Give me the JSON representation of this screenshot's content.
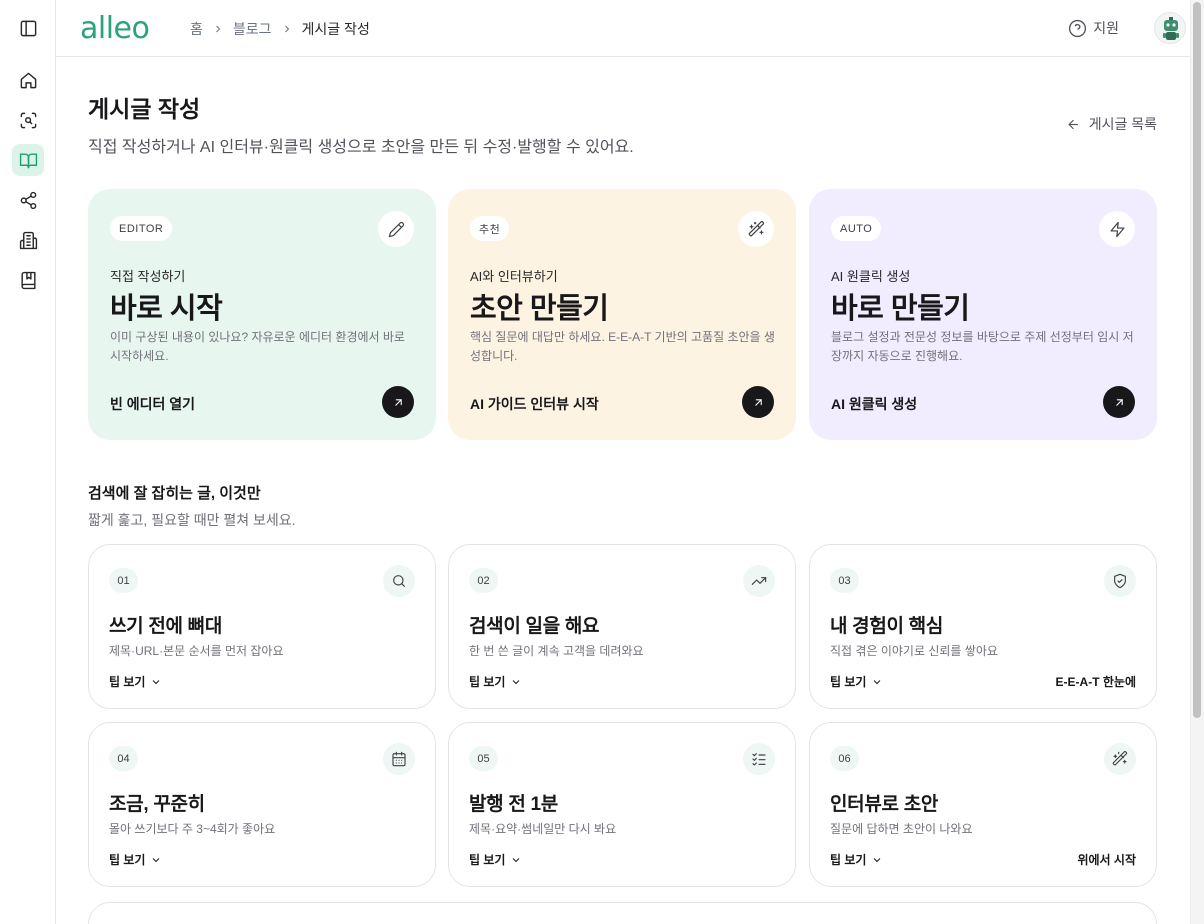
{
  "app": {
    "logo": "alleo",
    "support_label": "지원"
  },
  "breadcrumb": [
    "홈",
    "블로그",
    "게시글 작성"
  ],
  "sidebar": {
    "items": [
      {
        "name": "sidebar-toggle",
        "icon": "sidebar-panel-icon"
      },
      {
        "name": "home",
        "icon": "home-icon"
      },
      {
        "name": "scan",
        "icon": "scan-search-icon"
      },
      {
        "name": "blog",
        "icon": "book-open-icon",
        "active": true
      },
      {
        "name": "share",
        "icon": "share-icon"
      },
      {
        "name": "building",
        "icon": "building-icon"
      },
      {
        "name": "bookmark-book",
        "icon": "book-bookmark-icon"
      }
    ]
  },
  "page": {
    "title": "게시글 작성",
    "subtitle": "직접 작성하거나 AI 인터뷰·원클릭 생성으로 초안을 만든 뒤 수정·발행할 수 있어요.",
    "back_label": "게시글 목록"
  },
  "cards": [
    {
      "badge": "EDITOR",
      "icon": "pencil-icon",
      "kicker": "직접 작성하기",
      "headline": "바로 시작",
      "desc": "이미 구상된 내용이 있나요? 자유로운 에디터 환경에서 바로 시작하세요.",
      "action": "빈 에디터 열기",
      "bg": "#e8f6f0"
    },
    {
      "badge": "추천",
      "icon": "magic-wand-icon",
      "kicker": "AI와 인터뷰하기",
      "headline": "초안 만들기",
      "desc": "핵심 질문에 대답만 하세요. E-E-A-T 기반의 고품질 초안을 생성합니다.",
      "action": "AI 가이드 인터뷰 시작",
      "bg": "#fdf3e3"
    },
    {
      "badge": "AUTO",
      "icon": "lightning-icon",
      "kicker": "AI 원클릭 생성",
      "headline": "바로 만들기",
      "desc": "블로그 설정과 전문성 정보를 바탕으로 주제 선정부터 임시 저장까지 자동으로 진행해요.",
      "action": "AI 원클릭 생성",
      "bg": "#f1ecfe"
    }
  ],
  "tips_section": {
    "title": "검색에 잘 잡히는 글, 이것만",
    "subtitle": "짧게 훑고, 필요할 때만 펼쳐 보세요.",
    "more_label": "팁 보기",
    "tips": [
      {
        "num": "01",
        "icon": "search-icon",
        "title": "쓰기 전에 뼈대",
        "sub": "제목·URL·본문 순서를 먼저 잡아요",
        "extra": ""
      },
      {
        "num": "02",
        "icon": "trending-up-icon",
        "title": "검색이 일을 해요",
        "sub": "한 번 쓴 글이 계속 고객을 데려와요",
        "extra": ""
      },
      {
        "num": "03",
        "icon": "shield-check-icon",
        "title": "내 경험이 핵심",
        "sub": "직접 겪은 이야기로 신뢰를 쌓아요",
        "extra": "E-E-A-T 한눈에"
      },
      {
        "num": "04",
        "icon": "calendar-icon",
        "title": "조금, 꾸준히",
        "sub": "몰아 쓰기보다 주 3~4회가 좋아요",
        "extra": ""
      },
      {
        "num": "05",
        "icon": "checklist-icon",
        "title": "발행 전 1분",
        "sub": "제목·요약·썸네일만 다시 봐요",
        "extra": ""
      },
      {
        "num": "06",
        "icon": "magic-wand-icon",
        "title": "인터뷰로 초안",
        "sub": "질문에 답하면 초안이 나와요",
        "extra": "위에서 시작"
      }
    ]
  }
}
